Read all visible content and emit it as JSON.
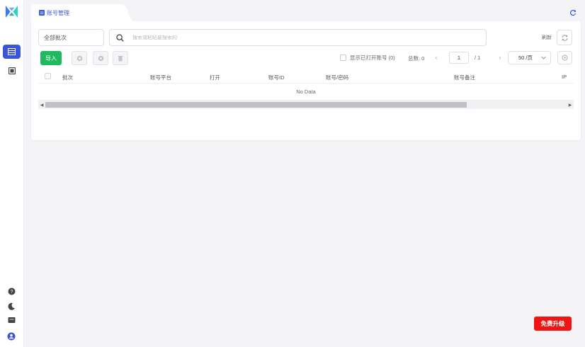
{
  "tab": {
    "label": "账号管理"
  },
  "toolbar": {
    "batch_select_value": "全部批次",
    "search_placeholder": "搜索或粘贴要搜索的",
    "filter_label": "刷新"
  },
  "actions": {
    "import_label": "导入"
  },
  "pagination": {
    "show_opened_label": "显示已打开账号 (0)",
    "total_label": "总数: 0",
    "current_page": "1",
    "of_label": "/ 1",
    "per_page": "50 /页"
  },
  "table": {
    "columns": [
      "批次",
      "账号平台",
      "打开",
      "账号ID",
      "账号/密码",
      "账号备注",
      "IP"
    ],
    "empty_text": "No Data"
  },
  "upgrade": {
    "label": "免费升级"
  },
  "colors": {
    "accent": "#3a55d9",
    "success": "#1fba5f",
    "danger": "#f01515"
  }
}
